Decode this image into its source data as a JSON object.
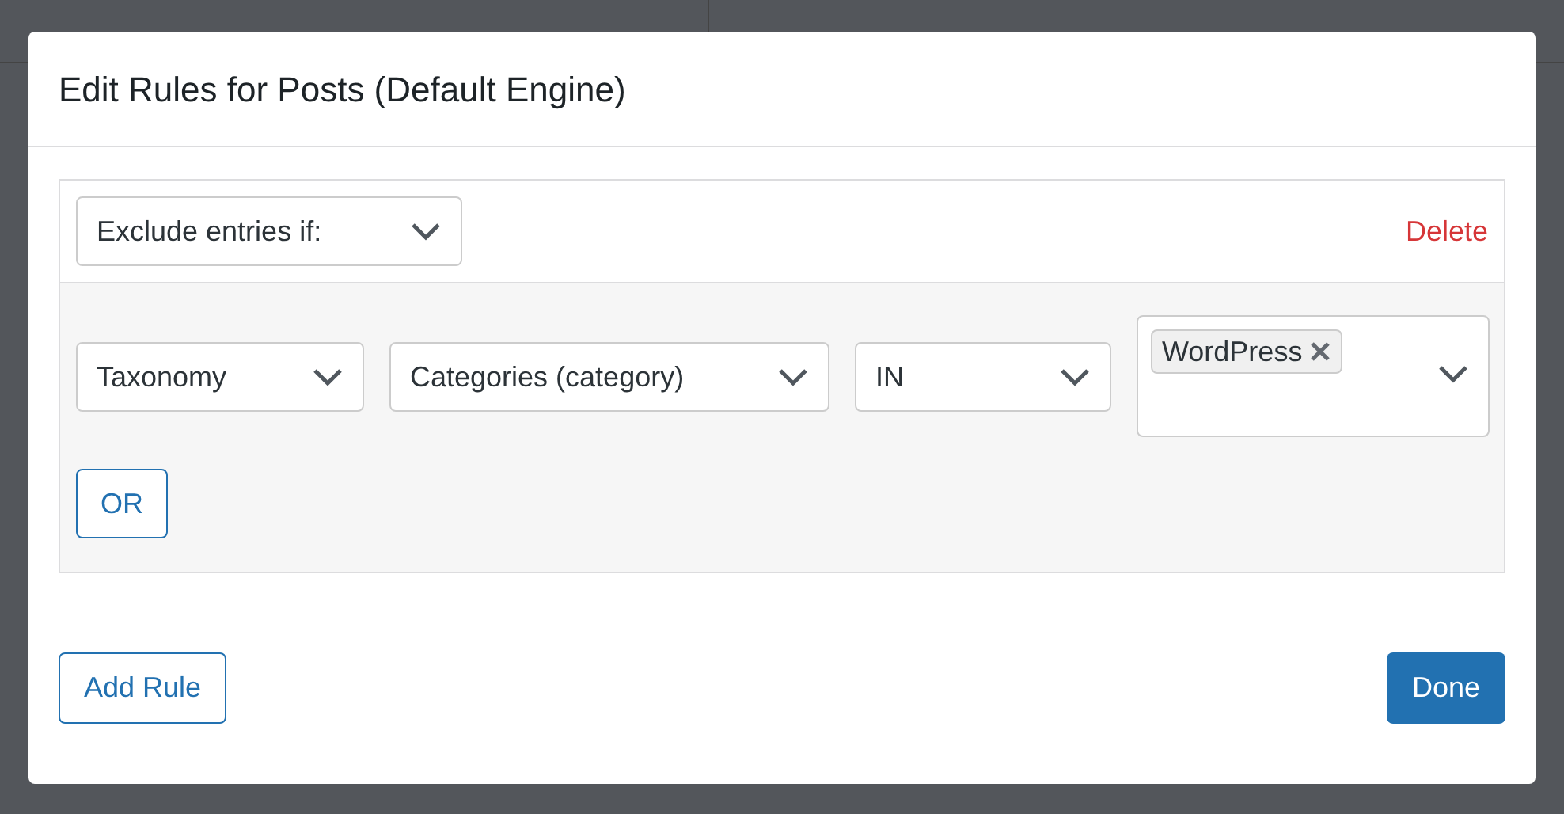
{
  "dialog": {
    "title": "Edit Rules for Posts (Default Engine)",
    "rule": {
      "mode": "Exclude entries if:",
      "delete": "Delete",
      "conditions": [
        {
          "kind": "select",
          "value": "Taxonomy"
        },
        {
          "kind": "select",
          "value": "Categories (category)"
        },
        {
          "kind": "select",
          "value": "IN"
        },
        {
          "kind": "tags",
          "tags": [
            "WordPress"
          ]
        }
      ],
      "or_button": "OR"
    },
    "add_rule": "Add Rule",
    "done": "Done"
  }
}
